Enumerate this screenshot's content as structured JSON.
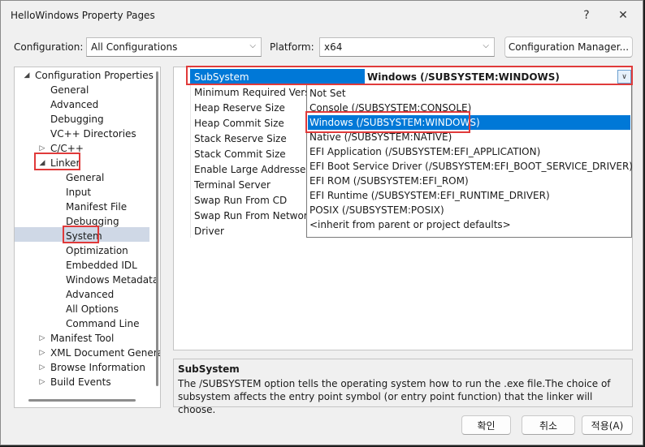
{
  "window": {
    "title": "HelloWindows Property Pages",
    "help_glyph": "?",
    "close_glyph": "✕"
  },
  "toolbar": {
    "configuration_label": "Configuration:",
    "configuration_value": "All Configurations",
    "platform_label": "Platform:",
    "platform_value": "x64",
    "config_manager_label": "Configuration Manager..."
  },
  "tree": {
    "items": [
      {
        "label": "Configuration Properties",
        "expander": "◢"
      },
      {
        "label": "General"
      },
      {
        "label": "Advanced"
      },
      {
        "label": "Debugging"
      },
      {
        "label": "VC++ Directories"
      },
      {
        "label": "C/C++",
        "expander": "▷"
      },
      {
        "label": "Linker",
        "expander": "◢"
      },
      {
        "label": "General"
      },
      {
        "label": "Input"
      },
      {
        "label": "Manifest File"
      },
      {
        "label": "Debugging"
      },
      {
        "label": "System"
      },
      {
        "label": "Optimization"
      },
      {
        "label": "Embedded IDL"
      },
      {
        "label": "Windows Metadata"
      },
      {
        "label": "Advanced"
      },
      {
        "label": "All Options"
      },
      {
        "label": "Command Line"
      },
      {
        "label": "Manifest Tool",
        "expander": "▷"
      },
      {
        "label": "XML Document Generator",
        "expander": "▷"
      },
      {
        "label": "Browse Information",
        "expander": "▷"
      },
      {
        "label": "Build Events",
        "expander": "▷"
      }
    ]
  },
  "grid": {
    "selected_property": "SubSystem",
    "selected_value": "Windows (/SUBSYSTEM:WINDOWS)",
    "dropdown_glyph": "∨",
    "properties": [
      "Minimum Required Version",
      "Heap Reserve Size",
      "Heap Commit Size",
      "Stack Reserve Size",
      "Stack Commit Size",
      "Enable Large Addresses",
      "Terminal Server",
      "Swap Run From CD",
      "Swap Run From Network",
      "Driver"
    ]
  },
  "dropdown": {
    "options": [
      "Not Set",
      "Console (/SUBSYSTEM:CONSOLE)",
      "Windows (/SUBSYSTEM:WINDOWS)",
      "Native (/SUBSYSTEM:NATIVE)",
      "EFI Application (/SUBSYSTEM:EFI_APPLICATION)",
      "EFI Boot Service Driver (/SUBSYSTEM:EFI_BOOT_SERVICE_DRIVER)",
      "EFI ROM (/SUBSYSTEM:EFI_ROM)",
      "EFI Runtime (/SUBSYSTEM:EFI_RUNTIME_DRIVER)",
      "POSIX (/SUBSYSTEM:POSIX)",
      "<inherit from parent or project defaults>"
    ],
    "selected_index": 2
  },
  "description": {
    "title": "SubSystem",
    "text": "The /SUBSYSTEM option tells the operating system how to run the .exe file.The choice of subsystem affects the entry point symbol (or entry point function) that the linker will choose."
  },
  "buttons": {
    "ok": "확인",
    "cancel": "취소",
    "apply": "적용(A)"
  },
  "colors": {
    "accent": "#0078d7",
    "highlight_box": "#e03a3a",
    "tree_selection": "#cfd8e6"
  }
}
